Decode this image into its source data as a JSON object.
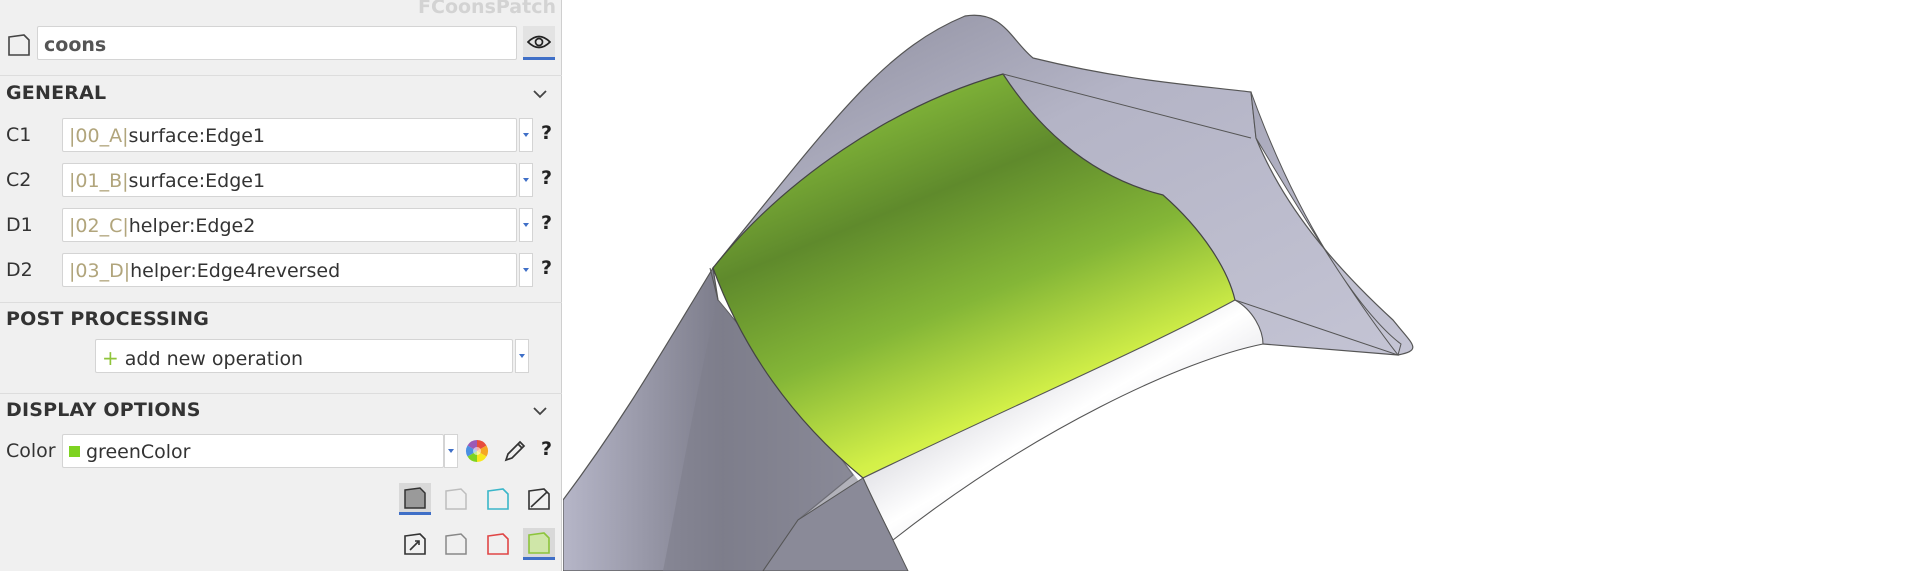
{
  "panel": {
    "object_type": "FCoonsPatch",
    "name": "coons",
    "sections": {
      "general": "GENERAL",
      "post_processing": "POST PROCESSING",
      "display_options": "DISPLAY OPTIONS"
    },
    "edges": [
      {
        "label": "C1",
        "prefix": "|00_A|",
        "value": "surface:Edge1",
        "help": "?"
      },
      {
        "label": "C2",
        "prefix": "|01_B|",
        "value": "surface:Edge1",
        "help": "?"
      },
      {
        "label": "D1",
        "prefix": "|02_C|",
        "value": "helper:Edge2",
        "help": "?"
      },
      {
        "label": "D2",
        "prefix": "|03_D|",
        "value": "helper:Edge4reversed",
        "help": "?"
      }
    ],
    "add_operation_label": "add new operation",
    "color": {
      "label": "Color",
      "value": "greenColor",
      "swatch": "#7ed321",
      "help": "?"
    }
  },
  "icons": {
    "type": "surface-icon",
    "visibility": "eye-icon",
    "collapse": "chevron-down-icon",
    "color_wheel": "color-wheel-icon",
    "pencil": "pencil-icon"
  },
  "colors": {
    "accent": "#3f6fc7",
    "prefix_text": "#b1a57c",
    "surface_green": "#8cc43b",
    "surface_grey": "#a3a3b4"
  }
}
